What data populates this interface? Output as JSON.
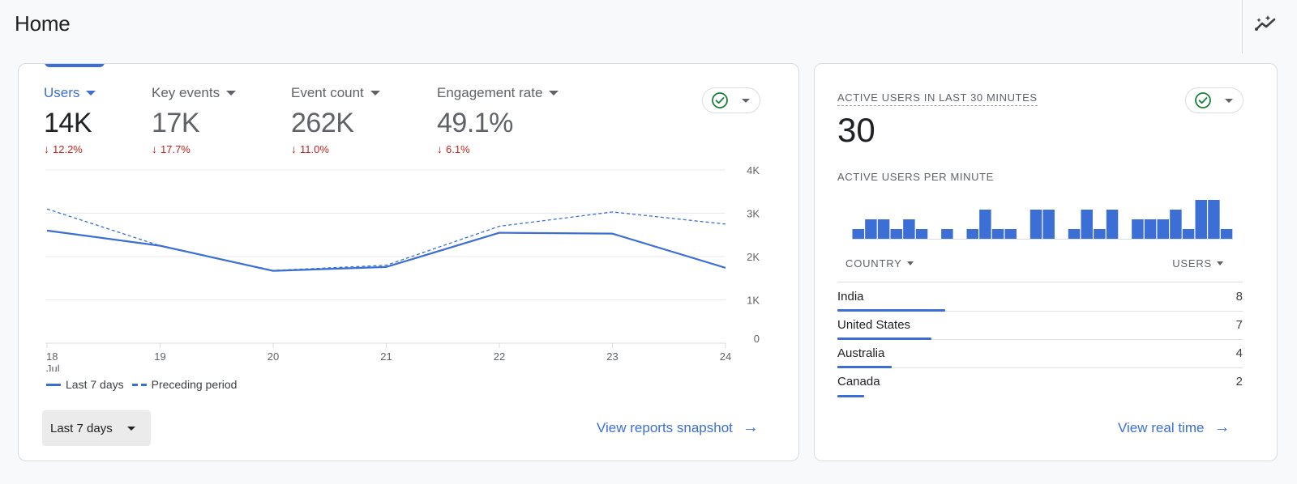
{
  "page": {
    "title": "Home",
    "insights_icon": "insights-sparkle-icon"
  },
  "overview_card": {
    "metrics": [
      {
        "label": "Users",
        "value": "14K",
        "change": "12.2%",
        "direction": "down",
        "active": true
      },
      {
        "label": "Key events",
        "value": "17K",
        "change": "17.7%",
        "direction": "down",
        "active": false
      },
      {
        "label": "Event count",
        "value": "262K",
        "change": "11.0%",
        "direction": "down",
        "active": false
      },
      {
        "label": "Engagement rate",
        "value": "49.1%",
        "change": "6.1%",
        "direction": "down",
        "active": false
      }
    ],
    "status_icon": "check-circle-icon",
    "legend": {
      "current": "Last 7 days",
      "previous": "Preceding period"
    },
    "date_range": {
      "selected": "Last 7 days"
    },
    "link": "View reports snapshot"
  },
  "chart_data": [
    {
      "type": "line",
      "title": "Users",
      "x": [
        "18",
        "19",
        "20",
        "21",
        "22",
        "23",
        "24"
      ],
      "x_sublabel": {
        "18": "Jul"
      },
      "yticks": [
        "0",
        "1K",
        "2K",
        "3K",
        "4K"
      ],
      "ylim": [
        0,
        4000
      ],
      "grid": true,
      "legend_position": "bottom-left",
      "series": [
        {
          "name": "Last 7 days",
          "style": "solid",
          "values": [
            2600,
            2250,
            1670,
            1760,
            2550,
            2530,
            1740
          ]
        },
        {
          "name": "Preceding period",
          "style": "dashed",
          "values": [
            3100,
            2250,
            1680,
            1800,
            2700,
            3030,
            2750
          ]
        }
      ],
      "color": "#3b6fd6"
    },
    {
      "type": "bar",
      "title": "Active users per minute",
      "values": [
        1,
        2,
        2,
        1,
        2,
        1,
        0,
        1,
        0,
        1,
        3,
        1,
        1,
        0,
        3,
        3,
        0,
        1,
        3,
        1,
        3,
        0,
        2,
        2,
        2,
        3,
        1,
        4,
        4,
        1
      ],
      "color": "#3b6fd6"
    }
  ],
  "realtime_card": {
    "heading": "ACTIVE USERS IN LAST 30 MINUTES",
    "value": "30",
    "subheading": "ACTIVE USERS PER MINUTE",
    "status_icon": "check-circle-icon",
    "table": {
      "columns": [
        "COUNTRY",
        "USERS"
      ],
      "rows": [
        {
          "country": "India",
          "users": 8
        },
        {
          "country": "United States",
          "users": 7
        },
        {
          "country": "Australia",
          "users": 4
        },
        {
          "country": "Canada",
          "users": 2
        }
      ]
    },
    "link": "View real time"
  },
  "colors": {
    "accent": "#3b6fd6",
    "negative": "#c5221f",
    "success": "#188038"
  }
}
